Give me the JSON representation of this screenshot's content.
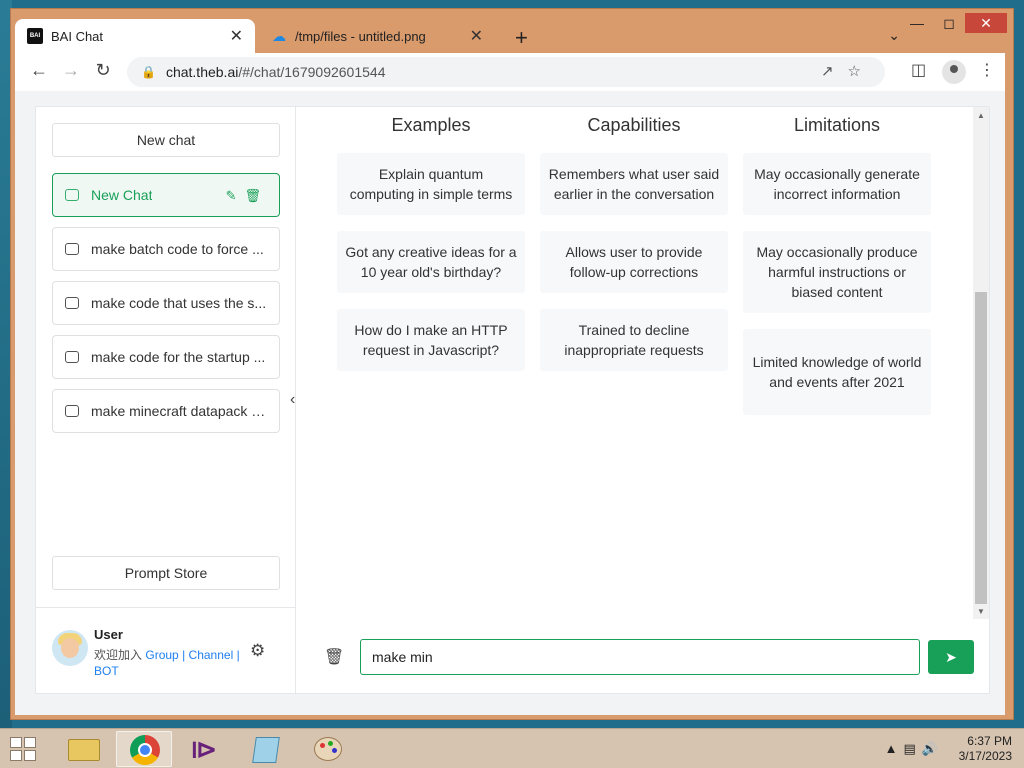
{
  "browser": {
    "tabs": [
      {
        "label": "BAI Chat",
        "favicon": "bai-logo-icon"
      },
      {
        "label": "/tmp/files - untitled.png",
        "favicon": "cloud-upload-icon"
      }
    ],
    "url_host": "chat.theb.ai",
    "url_path": "/#/chat/1679092601544"
  },
  "sidebar": {
    "new_chat_label": "New chat",
    "chats": [
      {
        "label": "New Chat",
        "active": true
      },
      {
        "label": "make batch code to force ...",
        "active": false
      },
      {
        "label": "make code that uses the s...",
        "active": false
      },
      {
        "label": "make code for the startup ...",
        "active": false
      },
      {
        "label": "make minecraft datapack c...",
        "active": false
      }
    ],
    "prompt_store_label": "Prompt Store",
    "user": {
      "name": "User",
      "desc_prefix": "欢迎加入",
      "link_group": "Group",
      "sep1": "|",
      "link_channel": "Channel",
      "sep2": "|",
      "link_bot": "BOT"
    }
  },
  "main": {
    "columns": [
      {
        "title": "Examples",
        "items": [
          "Explain quantum computing in simple terms",
          "Got any creative ideas for a 10 year old's birthday?",
          "How do I make an HTTP request in Javascript?"
        ]
      },
      {
        "title": "Capabilities",
        "items": [
          "Remembers what user said earlier in the conversation",
          "Allows user to provide follow-up corrections",
          "Trained to decline inappropriate requests"
        ]
      },
      {
        "title": "Limitations",
        "items": [
          "May occasionally generate incorrect information",
          "May occasionally produce harmful instructions or biased content",
          "Limited knowledge of world and events after 2021"
        ]
      }
    ],
    "input_value": "make min"
  },
  "taskbar": {
    "time": "6:37 PM",
    "date": "3/17/2023"
  },
  "colors": {
    "accent": "#18a058",
    "link": "#2080f0"
  }
}
